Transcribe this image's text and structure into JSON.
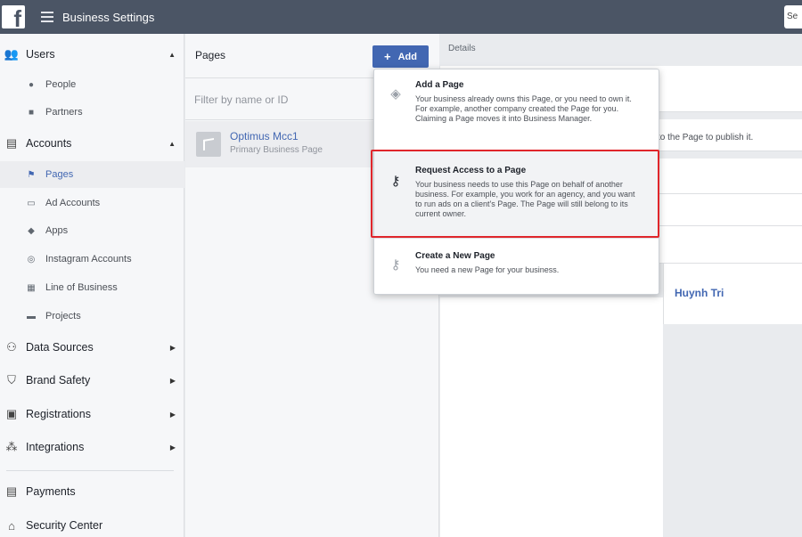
{
  "topbar": {
    "logo_letter": "f",
    "title": "Business Settings",
    "search_partial": "Se"
  },
  "sidebar": {
    "items": [
      {
        "label": "Users",
        "icon": "users-icon",
        "glyph": "👥",
        "type": "section",
        "caret": "▲"
      },
      {
        "label": "People",
        "icon": "person-icon",
        "glyph": "●",
        "type": "sub"
      },
      {
        "label": "Partners",
        "icon": "briefcase-icon",
        "glyph": "■",
        "type": "sub"
      },
      {
        "label": "Accounts",
        "icon": "accounts-icon",
        "glyph": "▤",
        "type": "section",
        "caret": "▲"
      },
      {
        "label": "Pages",
        "icon": "flag-icon",
        "glyph": "⚑",
        "type": "sub",
        "selected": true
      },
      {
        "label": "Ad Accounts",
        "icon": "ad-account-icon",
        "glyph": "▭",
        "type": "sub"
      },
      {
        "label": "Apps",
        "icon": "cube-icon",
        "glyph": "◆",
        "type": "sub"
      },
      {
        "label": "Instagram Accounts",
        "icon": "instagram-icon",
        "glyph": "◎",
        "type": "sub"
      },
      {
        "label": "Line of Business",
        "icon": "grid-icon",
        "glyph": "▦",
        "type": "sub"
      },
      {
        "label": "Projects",
        "icon": "folder-icon",
        "glyph": "▬",
        "type": "sub"
      },
      {
        "label": "Data Sources",
        "icon": "data-sources-icon",
        "glyph": "⚇",
        "type": "section",
        "caret": "▶"
      },
      {
        "label": "Brand Safety",
        "icon": "shield-icon",
        "glyph": "⛉",
        "type": "section",
        "caret": "▶"
      },
      {
        "label": "Registrations",
        "icon": "clipboard-icon",
        "glyph": "▣",
        "type": "section",
        "caret": "▶"
      },
      {
        "label": "Integrations",
        "icon": "integrations-icon",
        "glyph": "⁂",
        "type": "section",
        "caret": "▶"
      },
      {
        "label": "Payments",
        "icon": "payments-icon",
        "glyph": "▤",
        "type": "section"
      },
      {
        "label": "Security Center",
        "icon": "lock-icon",
        "glyph": "⌂",
        "type": "section"
      }
    ]
  },
  "pages_panel": {
    "title": "Pages",
    "add_label": "Add",
    "add_plus": "+",
    "filter_placeholder": "Filter by name or ID",
    "page_item": {
      "name": "Optimus Mcc1",
      "subtitle": "Primary Business Page"
    }
  },
  "details": {
    "label": "Details",
    "publish_text": "to the Page to publish it.",
    "person_name": "Huynh Tri"
  },
  "add_menu": {
    "options": [
      {
        "title": "Add a Page",
        "icon": "tag-icon",
        "glyph": "◈",
        "description": "Your business already owns this Page, or you need to own it. For example, another company created the Page for you. Claiming a Page moves it into Business Manager."
      },
      {
        "title": "Request Access to a Page",
        "icon": "key-icon",
        "glyph": "⚷",
        "description": "Your business needs to use this Page on behalf of another business. For example, you work for an agency, and you want to run ads on a client's Page. The Page will still belong to its current owner."
      },
      {
        "title": "Create a New Page",
        "icon": "key-outline-icon",
        "glyph": "⚷",
        "description": "You need a new Page for your business."
      }
    ]
  },
  "colors": {
    "topbar": "#4b5565",
    "accent": "#4267b2",
    "highlight_border": "#e0262b"
  }
}
